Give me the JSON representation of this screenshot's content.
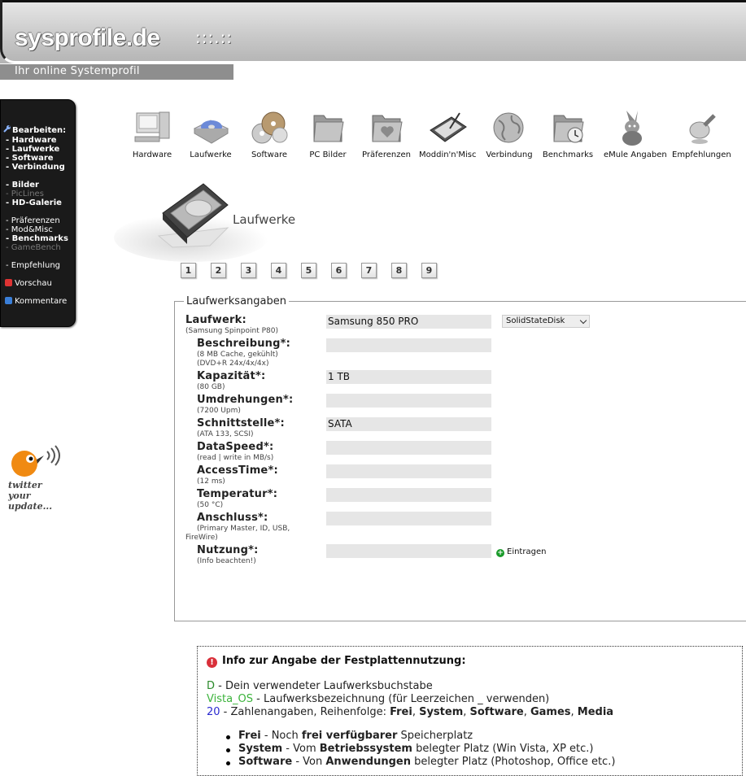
{
  "site": {
    "logo": "sysprofile.de",
    "logo_dots": ":::.::",
    "subtitle": "Ihr online Systemprofil"
  },
  "sidebar": {
    "edit_label": "Bearbeiten:",
    "items": [
      {
        "label": "- Hardware",
        "state": "active"
      },
      {
        "label": "- Laufwerke",
        "state": "active"
      },
      {
        "label": "- Software",
        "state": "active"
      },
      {
        "label": "- Verbindung",
        "state": "active"
      },
      {
        "label": "- Bilder",
        "state": "active"
      },
      {
        "label": "- PicLines",
        "state": "disabled"
      },
      {
        "label": "- HD-Galerie",
        "state": "active"
      },
      {
        "label": "- Präferenzen",
        "state": "active"
      },
      {
        "label": "- Mod&Misc",
        "state": "active"
      },
      {
        "label": "- Benchmarks",
        "state": "active"
      },
      {
        "label": "- GameBench",
        "state": "disabled"
      },
      {
        "label": "- Empfehlung",
        "state": "active"
      }
    ],
    "preview_label": "Vorschau",
    "comments_label": "Kommentare"
  },
  "twitter": {
    "text_line1": "twitter",
    "text_line2": "your",
    "text_line3": "update..."
  },
  "nav": [
    {
      "label": "Hardware",
      "icon": "computer-icon"
    },
    {
      "label": "Laufwerke",
      "icon": "disc-drive-icon"
    },
    {
      "label": "Software",
      "icon": "software-cds-icon"
    },
    {
      "label": "PC Bilder",
      "icon": "folder-icon"
    },
    {
      "label": "Präferenzen",
      "icon": "heart-folder-icon"
    },
    {
      "label": "Moddin'n'Misc",
      "icon": "tablet-icon"
    },
    {
      "label": "Verbindung",
      "icon": "globe-icon"
    },
    {
      "label": "Benchmarks",
      "icon": "clock-folder-icon"
    },
    {
      "label": "eMule Angaben",
      "icon": "mule-icon"
    },
    {
      "label": "Empfehlungen",
      "icon": "glass-icon"
    }
  ],
  "section": {
    "title": "Laufwerke"
  },
  "pages": [
    "1",
    "2",
    "3",
    "4",
    "5",
    "6",
    "7",
    "8",
    "9"
  ],
  "form": {
    "legend": "Laufwerksangaben",
    "fields": [
      {
        "label": "Laufwerk:",
        "hint": "(Samsung Spinpoint P80)",
        "value": "Samsung 850 PRO"
      },
      {
        "label": "Beschreibung*:",
        "hint": "(8 MB Cache, gekühlt)\n(DVD+R 24x/4x/4x)",
        "value": ""
      },
      {
        "label": "Kapazität*:",
        "hint": "(80 GB)",
        "value": "1 TB"
      },
      {
        "label": "Umdrehungen*:",
        "hint": "(7200 Upm)",
        "value": ""
      },
      {
        "label": "Schnittstelle*:",
        "hint": "(ATA 133, SCSI)",
        "value": "SATA"
      },
      {
        "label": "DataSpeed*:",
        "hint": "(read | write in MB/s)",
        "value": ""
      },
      {
        "label": "AccessTime*:",
        "hint": "(12 ms)",
        "value": ""
      },
      {
        "label": "Temperatur*:",
        "hint": "(50 °C)",
        "value": ""
      },
      {
        "label": "Anschluss*:",
        "hint": "(Primary Master, ID, USB,\nFireWire)",
        "value": ""
      },
      {
        "label": "Nutzung*:",
        "hint": "(Info beachten!)",
        "value": ""
      }
    ],
    "drive_type": "SolidStateDisk",
    "submit_label": "Eintragen"
  },
  "info": {
    "title": "Info zur Angabe der Festplattennutzung:",
    "line_d_key": "D",
    "line_d_text": " - Dein verwendeter Laufwerksbuchstabe",
    "line_v_key": "Vista_OS",
    "line_v_text": " - Laufwerksbezeichnung (für Leerzeichen _ verwenden)",
    "line_n_key": "20",
    "line_n_text": " - Zahlenangaben, Reihenfolge: ",
    "order": [
      "Frei",
      "System",
      "Software",
      "Games",
      "Media"
    ],
    "bullets": [
      {
        "term": "Frei",
        "pre": " - Noch ",
        "bold": "frei verfügbarer",
        "post": " Speicherplatz"
      },
      {
        "term": "System",
        "pre": " - Vom ",
        "bold": "Betriebssystem",
        "post": " belegter Platz (Win Vista, XP etc.)"
      },
      {
        "term": "Software",
        "pre": " - Von ",
        "bold": "Anwendungen",
        "post": " belegter Platz (Photoshop, Office etc.)"
      }
    ]
  }
}
